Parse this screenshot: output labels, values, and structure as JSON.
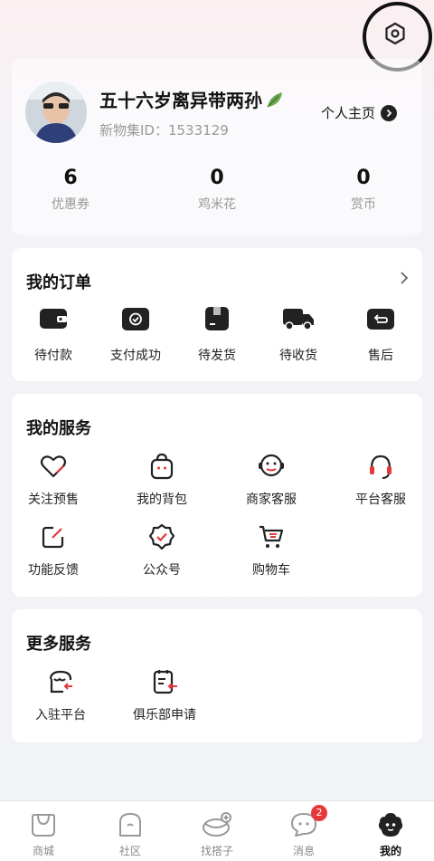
{
  "profile": {
    "nickname": "五十六岁离异带两孙",
    "user_id": "新物集ID：1533129",
    "homepage_label": "个人主页"
  },
  "stats": [
    {
      "value": "6",
      "label": "优惠券"
    },
    {
      "value": "0",
      "label": "鸡米花"
    },
    {
      "value": "0",
      "label": "赏币"
    }
  ],
  "orders": {
    "title": "我的订单",
    "items": [
      {
        "label": "待付款",
        "icon": "wallet-icon"
      },
      {
        "label": "支付成功",
        "icon": "payment-success-icon"
      },
      {
        "label": "待发货",
        "icon": "package-icon"
      },
      {
        "label": "待收货",
        "icon": "truck-icon"
      },
      {
        "label": "售后",
        "icon": "return-icon"
      }
    ]
  },
  "services": {
    "title": "我的服务",
    "items": [
      {
        "label": "关注预售",
        "icon": "heart-icon"
      },
      {
        "label": "我的背包",
        "icon": "backpack-icon"
      },
      {
        "label": "商家客服",
        "icon": "merchant-support-icon"
      },
      {
        "label": "平台客服",
        "icon": "headset-icon"
      },
      {
        "label": "功能反馈",
        "icon": "feedback-icon"
      },
      {
        "label": "公众号",
        "icon": "official-account-icon"
      },
      {
        "label": "购物车",
        "icon": "cart-icon"
      }
    ]
  },
  "more_services": {
    "title": "更多服务",
    "items": [
      {
        "label": "入驻平台",
        "icon": "store-enter-icon"
      },
      {
        "label": "俱乐部申请",
        "icon": "club-apply-icon"
      }
    ]
  },
  "tabbar": {
    "items": [
      {
        "label": "商城",
        "icon": "mall-icon"
      },
      {
        "label": "社区",
        "icon": "community-icon"
      },
      {
        "label": "找搭子",
        "icon": "find-partner-icon"
      },
      {
        "label": "消息",
        "icon": "message-icon",
        "badge": "2"
      },
      {
        "label": "我的",
        "icon": "profile-icon",
        "active": true
      }
    ]
  },
  "colors": {
    "accent": "#e5383b",
    "icon_dark": "#222222",
    "muted": "#999999"
  }
}
